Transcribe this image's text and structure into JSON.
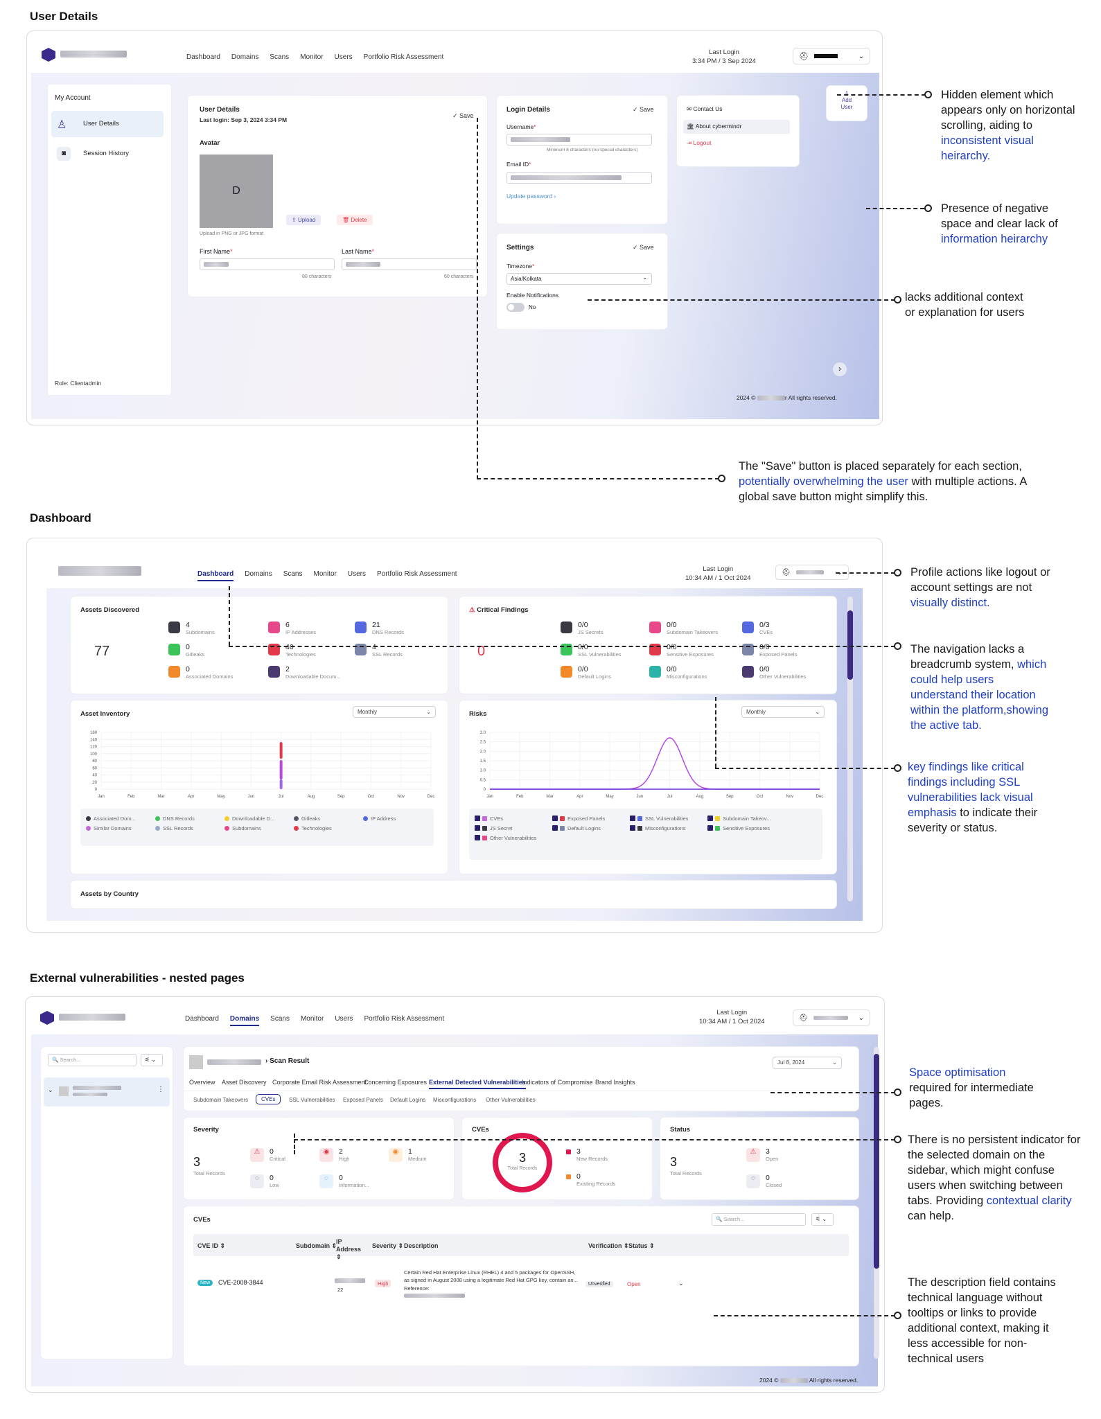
{
  "sections": {
    "user_details": "User Details",
    "dashboard": "Dashboard",
    "external": "External vulnerabilities - nested pages"
  },
  "nav": {
    "dashboard": "Dashboard",
    "domains": "Domains",
    "scans": "Scans",
    "monitor": "Monitor",
    "users": "Users",
    "portfolio": "Portfolio Risk Assessment"
  },
  "ud": {
    "last_login_label": "Last Login",
    "last_login": "3:34 PM / 3 Sep 2024",
    "my_account": "My Account",
    "side_user_details": "User Details",
    "side_session": "Session History",
    "role": "Role: Clientadmin",
    "card_title": "User Details",
    "card_last_login": "Last login: Sep 3, 2024 3:34 PM",
    "save": "Save",
    "avatar": "Avatar",
    "avatar_letter": "D",
    "upload": "Upload",
    "delete": "Delete",
    "upload_hint": "Upload in PNG or JPG format",
    "first_name": "First Name",
    "last_name": "Last Name",
    "chars_80": "80 characters",
    "chars_60": "60 characters",
    "login_details": "Login Details",
    "username": "Username",
    "username_hint": "Minimum 8 characters (no special characters)",
    "email": "Email ID",
    "update_password": "Update password",
    "settings": "Settings",
    "timezone": "Timezone",
    "timezone_val": "Asia/Kolkata",
    "enable_notif": "Enable Notifications",
    "no": "No",
    "contact": "Contact Us",
    "about": "About cybermindr",
    "logout": "Logout",
    "add_user": "Add User",
    "footer": "2024 © ",
    "footer_suffix": "r All rights reserved."
  },
  "db": {
    "last_login_label": "Last Login",
    "last_login": "10:34 AM / 1 Oct 2024",
    "assets_title": "Assets Discovered",
    "assets_total": "77",
    "assets": [
      {
        "v": "4",
        "s": "Subdomains"
      },
      {
        "v": "6",
        "s": "IP Addresses"
      },
      {
        "v": "21",
        "s": "DNS Records"
      },
      {
        "v": "0",
        "s": "Gitleaks"
      },
      {
        "v": "40",
        "s": "Technologies"
      },
      {
        "v": "4",
        "s": "SSL Records"
      },
      {
        "v": "0",
        "s": "Associated Domains"
      },
      {
        "v": "2",
        "s": "Downloadable Docum..."
      }
    ],
    "crit_title": "Critical Findings",
    "crit_total": "0",
    "crit": [
      {
        "v": "0/0",
        "s": "JS Secrets"
      },
      {
        "v": "0/0",
        "s": "Subdomain Takeovers"
      },
      {
        "v": "0/3",
        "s": "CVEs"
      },
      {
        "v": "0/0",
        "s": "SSL Vulnerabilities"
      },
      {
        "v": "0/0",
        "s": "Sensitive Exposures"
      },
      {
        "v": "0/0",
        "s": "Exposed Panels"
      },
      {
        "v": "0/0",
        "s": "Default Logins"
      },
      {
        "v": "0/0",
        "s": "Misconfigurations"
      },
      {
        "v": "0/0",
        "s": "Other Vulnerabilities"
      }
    ],
    "inventory_title": "Asset Inventory",
    "monthly": "Monthly",
    "risks_title": "Risks",
    "months": [
      "Jan",
      "Feb",
      "Mar",
      "Apr",
      "May",
      "Jun",
      "Jul",
      "Aug",
      "Sep",
      "Oct",
      "Nov",
      "Dec"
    ],
    "inv_ticks": [
      "160",
      "140",
      "120",
      "100",
      "80",
      "60",
      "40",
      "20",
      "0"
    ],
    "risk_ticks": [
      "3.0",
      "2.5",
      "2.0",
      "1.5",
      "1.0",
      "0.5",
      "0"
    ],
    "inv_legend": [
      "Associated Dom...",
      "DNS Records",
      "Downloadable D...",
      "Gitleaks",
      "IP Address",
      "Similar Domains",
      "SSL Records",
      "Subdomains",
      "Technologies"
    ],
    "risk_legend": [
      "CVEs",
      "Exposed Panels",
      "SSL Vulnerabilities",
      "Subdomain Takeov...",
      "JS Secret",
      "Default Logins",
      "Misconfigurations",
      "Sensitive Exposures",
      "Other Vulnerabilities"
    ],
    "by_country": "Assets by Country"
  },
  "ev": {
    "last_login_label": "Last Login",
    "last_login": "10:34 AM / 1 Oct 2024",
    "search": "Search...",
    "scan_result": "Scan Result",
    "date": "Jul 8, 2024",
    "tabs": [
      "Overview",
      "Asset Discovery",
      "Corporate Email Risk Assessment",
      "Concerning Exposures",
      "External Detected Vulnerabilities",
      "Indicators of Compromise",
      "Brand Insights"
    ],
    "subtabs": [
      "Subdomain Takeovers",
      "CVEs",
      "SSL Vulnerabilities",
      "Exposed Panels",
      "Default Logins",
      "Misconfigurations",
      "Other Vulnerabilities"
    ],
    "severity": "Severity",
    "total": "3",
    "total_records": "Total Records",
    "sev": [
      {
        "v": "0",
        "s": "Critical"
      },
      {
        "v": "2",
        "s": "High"
      },
      {
        "v": "1",
        "s": "Medium"
      },
      {
        "v": "0",
        "s": "Low"
      },
      {
        "v": "0",
        "s": "Information..."
      }
    ],
    "cves": "CVEs",
    "new_records": "New Records",
    "new_v": "3",
    "existing_records": "Existing Records",
    "existing_v": "0",
    "status": "Status",
    "open": "Open",
    "open_v": "3",
    "closed": "Closed",
    "closed_v": "0",
    "table_title": "CVEs",
    "cols": [
      "CVE ID",
      "Subdomain",
      "IP Address",
      "Severity",
      "Description",
      "Verification",
      "Status"
    ],
    "row": {
      "badge": "New",
      "id": "CVE-2008-3844",
      "ip_tail": "22",
      "sev": "High",
      "desc": "Certain Red Hat Enterprise Linux (RHEL) 4 and 5 packages for OpenSSH, as signed in August 2008 using a legitimate Red Hat GPG key, contain an...",
      "ref": "Reference:",
      "verif": "Unverified",
      "status": "Open"
    },
    "footer": "2024 © ",
    "footer_suffix": "All rights reserved."
  },
  "annotations": {
    "a1": {
      "t1": "Hidden element which appears only on horizontal scrolling, aiding to ",
      "b": "inconsistent visual heirarchy."
    },
    "a2": {
      "t1": "Presence of negative space and clear lack of ",
      "b": "information heirarchy"
    },
    "a3": {
      "t1": "lacks additional context or explanation for users"
    },
    "a4": {
      "t1": "The \"Save\" button is placed separately for each section, ",
      "b": "potentially overwhelming the user",
      "t2": " with multiple actions. A global save button might simplify this."
    },
    "a5": {
      "t1": "Profile actions like logout or account settings are not ",
      "b": "visually distinct."
    },
    "a6": {
      "t1": "The navigation lacks a breadcrumb system, ",
      "b": "which could help users understand their location within the platform,showing the active tab."
    },
    "a7": {
      "b": "key findings like critical findings including SSL vulnerabilities lack visual emphasis",
      "t2": " to indicate their severity or status."
    },
    "a8": {
      "b": "Space optimisation",
      "t2": " required for intermediate pages."
    },
    "a9": {
      "t1": "There is no persistent indicator for the selected domain on the sidebar, which might confuse users when switching between tabs. Providing ",
      "b": "contextual clarity",
      "t2": " can help."
    },
    "a10": {
      "t1": "The description field contains technical language without tooltips or links to provide additional context, making it less accessible for non-technical users"
    }
  }
}
